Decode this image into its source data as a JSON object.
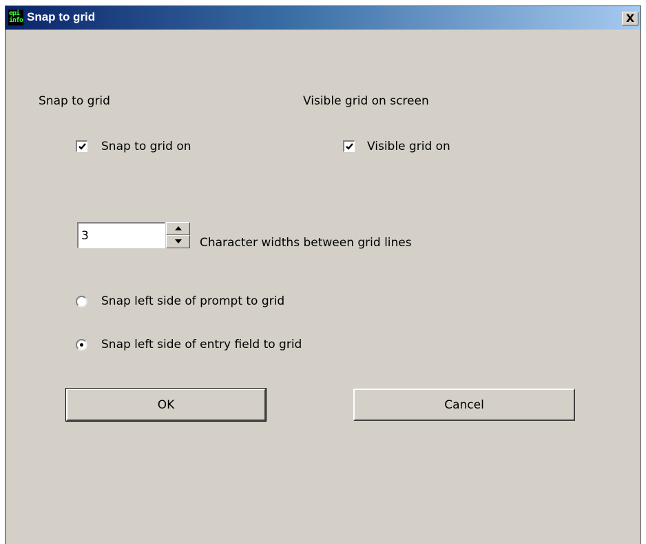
{
  "window": {
    "title": "Snap to grid",
    "icon": "epi-info-icon",
    "icon_text_top": "epi",
    "icon_text_bottom": "info",
    "close_glyph": "X"
  },
  "snap_section": {
    "heading": "Snap to grid",
    "checkbox_label": "Snap to grid on",
    "checked": true
  },
  "visible_section": {
    "heading": "Visible grid on screen",
    "checkbox_label": "Visible grid on",
    "checked": true
  },
  "grid_spacing": {
    "value": "3",
    "label": "Character widths between grid lines"
  },
  "snap_options": [
    {
      "label": "Snap left side of prompt to grid",
      "selected": false
    },
    {
      "label": "Snap left side of entry field to grid",
      "selected": true
    }
  ],
  "buttons": {
    "ok": "OK",
    "cancel": "Cancel"
  },
  "colors": {
    "dialog_bg": "#d4d0c8",
    "titlebar_start": "#0a246a",
    "titlebar_end": "#a6caf0"
  }
}
